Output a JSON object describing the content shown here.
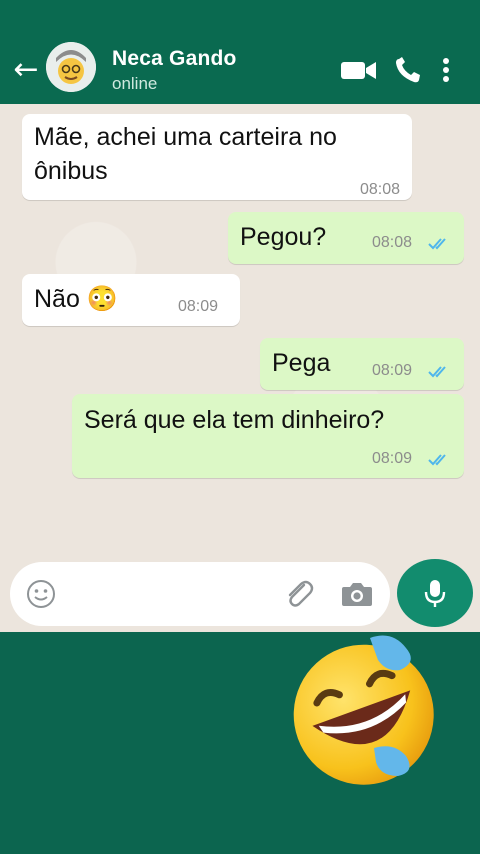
{
  "header": {
    "contact_name": "Neca Gando",
    "status": "online",
    "icons": [
      "back-arrow-icon",
      "avatar",
      "video-call-icon",
      "phone-icon",
      "more-vert-icon"
    ]
  },
  "messages": [
    {
      "dir": "in",
      "text_line1": "Mãe, achei uma carteira no",
      "text_line2": "ônibus",
      "time": "08:08"
    },
    {
      "dir": "out",
      "text": "Pegou?",
      "time": "08:08",
      "ticks": "double-check-icon"
    },
    {
      "dir": "in",
      "text": "Não 😳",
      "time": "08:09"
    },
    {
      "dir": "out",
      "text": "Pega",
      "time": "08:09",
      "ticks": "double-check-icon"
    },
    {
      "dir": "out",
      "text": "Será que ela tem dinheiro?",
      "time": "08:09",
      "ticks": "double-check-icon"
    }
  ],
  "composer": {
    "icons": [
      "emoji-icon",
      "attachment-icon",
      "camera-icon",
      "mic-icon"
    ]
  },
  "overlay": {
    "emoji": "laughing-tears-emoji"
  },
  "colors": {
    "header": "#0a6a50",
    "outgoing_bubble": "#dcf8c6",
    "incoming_bubble": "#ffffff",
    "mic_button": "#128c6e",
    "tick": "#4fb6ec"
  }
}
